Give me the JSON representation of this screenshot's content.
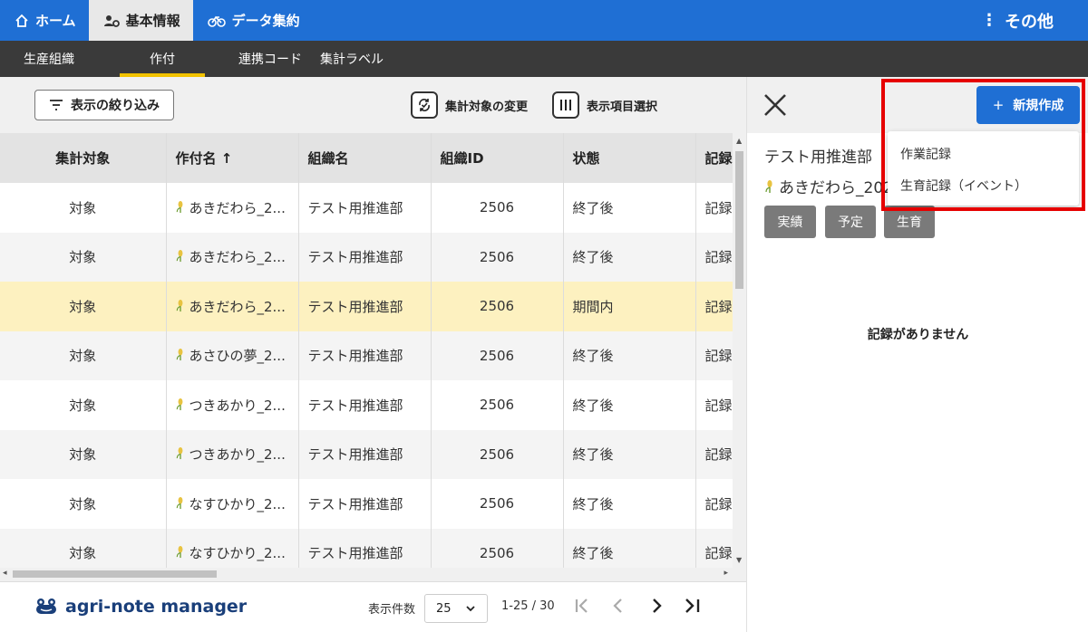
{
  "topnav": {
    "items": [
      {
        "label": "ホーム",
        "icon": "home-icon",
        "active": false
      },
      {
        "label": "基本情報",
        "icon": "org-settings-icon",
        "active": true
      },
      {
        "label": "データ集約",
        "icon": "bicycle-icon",
        "active": false
      }
    ],
    "more_label": "その他"
  },
  "subnav": {
    "items": [
      {
        "label": "生産組織",
        "active": false
      },
      {
        "label": "作付",
        "active": true
      },
      {
        "label": "連携コード",
        "active": false
      },
      {
        "label": "集計ラベル",
        "active": false
      }
    ]
  },
  "toolbar": {
    "filter_label": "表示の絞り込み",
    "target_change_label": "集計対象の変更",
    "column_select_label": "表示項目選択"
  },
  "table": {
    "headers": [
      "集計対象",
      "作付名 ↑",
      "組織名",
      "組織ID",
      "状態",
      "記録"
    ],
    "rows": [
      {
        "target": "対象",
        "crop": "あきだわら_2...",
        "org": "テスト用推進部",
        "org_id": "2506",
        "status": "終了後",
        "record": "記録"
      },
      {
        "target": "対象",
        "crop": "あきだわら_2...",
        "org": "テスト用推進部",
        "org_id": "2506",
        "status": "終了後",
        "record": "記録"
      },
      {
        "target": "対象",
        "crop": "あきだわら_2...",
        "org": "テスト用推進部",
        "org_id": "2506",
        "status": "期間内",
        "record": "記録"
      },
      {
        "target": "対象",
        "crop": "あさひの夢_2...",
        "org": "テスト用推進部",
        "org_id": "2506",
        "status": "終了後",
        "record": "記録"
      },
      {
        "target": "対象",
        "crop": "つきあかり_2...",
        "org": "テスト用推進部",
        "org_id": "2506",
        "status": "終了後",
        "record": "記録"
      },
      {
        "target": "対象",
        "crop": "つきあかり_2...",
        "org": "テスト用推進部",
        "org_id": "2506",
        "status": "終了後",
        "record": "記録"
      },
      {
        "target": "対象",
        "crop": "なすひかり_2...",
        "org": "テスト用推進部",
        "org_id": "2506",
        "status": "終了後",
        "record": "記録"
      },
      {
        "target": "対象",
        "crop": "なすひかり_2...",
        "org": "テスト用推進部",
        "org_id": "2506",
        "status": "終了後",
        "record": "記録"
      }
    ],
    "highlight_row": 2
  },
  "footer": {
    "logo_text": "agri-note manager",
    "perpage_label": "表示件数",
    "perpage_value": "25",
    "range_text": "1-25 / 30"
  },
  "detail": {
    "org_name": "テスト用推進部",
    "crop_name": "あきだわら_2020",
    "chips": [
      "実績",
      "予定",
      "生育"
    ],
    "empty_message": "記録がありません",
    "new_button_label": "新規作成",
    "new_button_plus": "+",
    "dropdown_options": [
      "作業記録",
      "生育記録（イベント）"
    ]
  },
  "colors": {
    "primary": "#1f6fd4",
    "subnav_bg": "#3a3a3a",
    "active_underline": "#f2c200",
    "highlight_row": "#fdf1c0",
    "annotation_red": "#e60000"
  }
}
